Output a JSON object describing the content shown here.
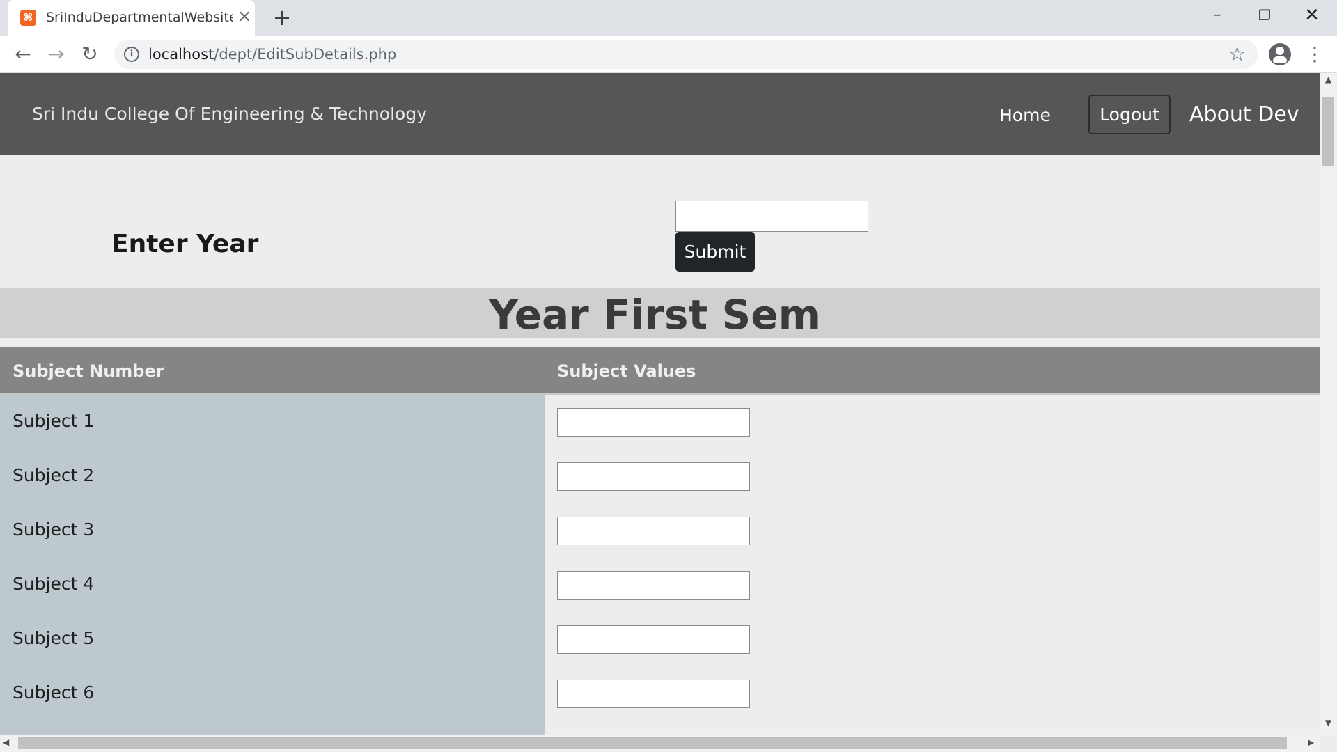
{
  "browser": {
    "tab_title": "SriInduDepartmentalWebsite-Final",
    "favicon": "xampp-icon",
    "url_host": "localhost",
    "url_path": "/dept/EditSubDetails.php"
  },
  "navbar": {
    "brand": "Sri Indu College Of Engineering & Technology",
    "home": "Home",
    "logout": "Logout",
    "about": "About Dev"
  },
  "form": {
    "label": "Enter Year",
    "year_value": "",
    "submit": "Submit"
  },
  "section": {
    "title": "Year First Sem"
  },
  "table": {
    "headers": [
      "Subject Number",
      "Subject Values"
    ],
    "rows": [
      {
        "label": "Subject 1",
        "value": ""
      },
      {
        "label": "Subject 2",
        "value": ""
      },
      {
        "label": "Subject 3",
        "value": ""
      },
      {
        "label": "Subject 4",
        "value": ""
      },
      {
        "label": "Subject 5",
        "value": ""
      },
      {
        "label": "Subject 6",
        "value": ""
      }
    ]
  },
  "colors": {
    "navbar_bg": "#555757",
    "submit_bg": "#212529",
    "table_header_bg": "#858585",
    "label_cell_bg": "#bdc9cf",
    "banner_bg": "#d0d0d0"
  }
}
